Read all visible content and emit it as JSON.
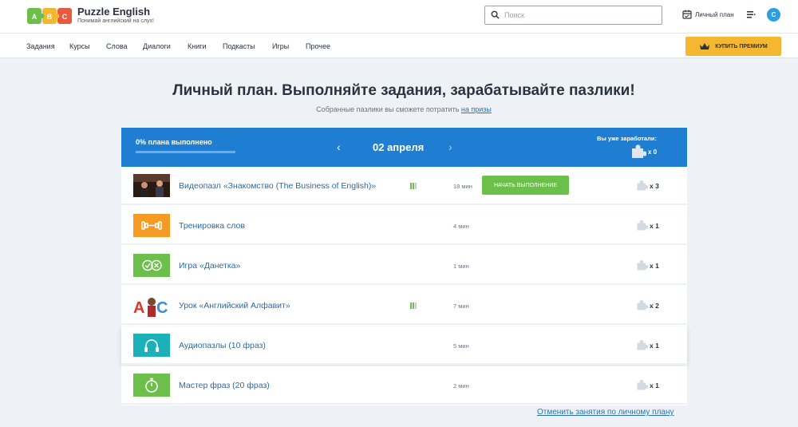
{
  "header": {
    "brand_name": "Puzzle English",
    "brand_tagline": "Понимай английский на слух!",
    "logo_letters": [
      "A",
      "B",
      "C"
    ],
    "search_placeholder": "Поиск",
    "plan_label": "Личный план",
    "avatar_letter": "С"
  },
  "nav": {
    "items": [
      "Задания",
      "Курсы",
      "Слова",
      "Диалоги",
      "Книги",
      "Подкасты",
      "Игры",
      "Прочее"
    ],
    "premium_label": "КУПИТЬ ПРЕМИУМ"
  },
  "page": {
    "title": "Личный план. Выполняйте задания, зарабатывайте пазлики!",
    "subtitle_text": "Собранные пазлики вы сможете потратить",
    "subtitle_link": "на призы"
  },
  "banner": {
    "progress_text": "0% плана выполнено",
    "progress": 0,
    "date": "02 апреля",
    "earned_label": "Вы уже заработали:",
    "earned_count": "x 0"
  },
  "tasks": [
    {
      "title": "Видеопазл «Знакомство (The Business of English)»",
      "time": "18 мин",
      "reward": "x 3",
      "level": true,
      "start_label": "НАЧАТЬ ВЫПОЛНЕНИЕ",
      "icon": "video-thumbnail"
    },
    {
      "title": "Тренировка слов",
      "time": "4 мин",
      "reward": "x 1",
      "level": false,
      "icon": "dumbbell-icon"
    },
    {
      "title": "Игра «Данетка»",
      "time": "1 мин",
      "reward": "x 1",
      "level": false,
      "icon": "check-cross-icon"
    },
    {
      "title": "Урок «Английский Алфавит»",
      "time": "7 мин",
      "reward": "x 2",
      "level": true,
      "icon": "alphabet-thumbnail"
    },
    {
      "title": "Аудиопазлы (10 фраз)",
      "time": "5 мин",
      "reward": "x 1",
      "level": false,
      "icon": "headphones-icon"
    },
    {
      "title": "Мастер фраз (20 фраз)",
      "time": "2 мин",
      "reward": "x 1",
      "level": false,
      "icon": "stopwatch-icon"
    }
  ],
  "colors": {
    "banner": "#1f7ed1",
    "start": "#6cbf4b",
    "premium": "#f5b730",
    "link": "#2a73b8"
  },
  "footer": {
    "cancel_label": "Отменить занятия по личному плану"
  }
}
